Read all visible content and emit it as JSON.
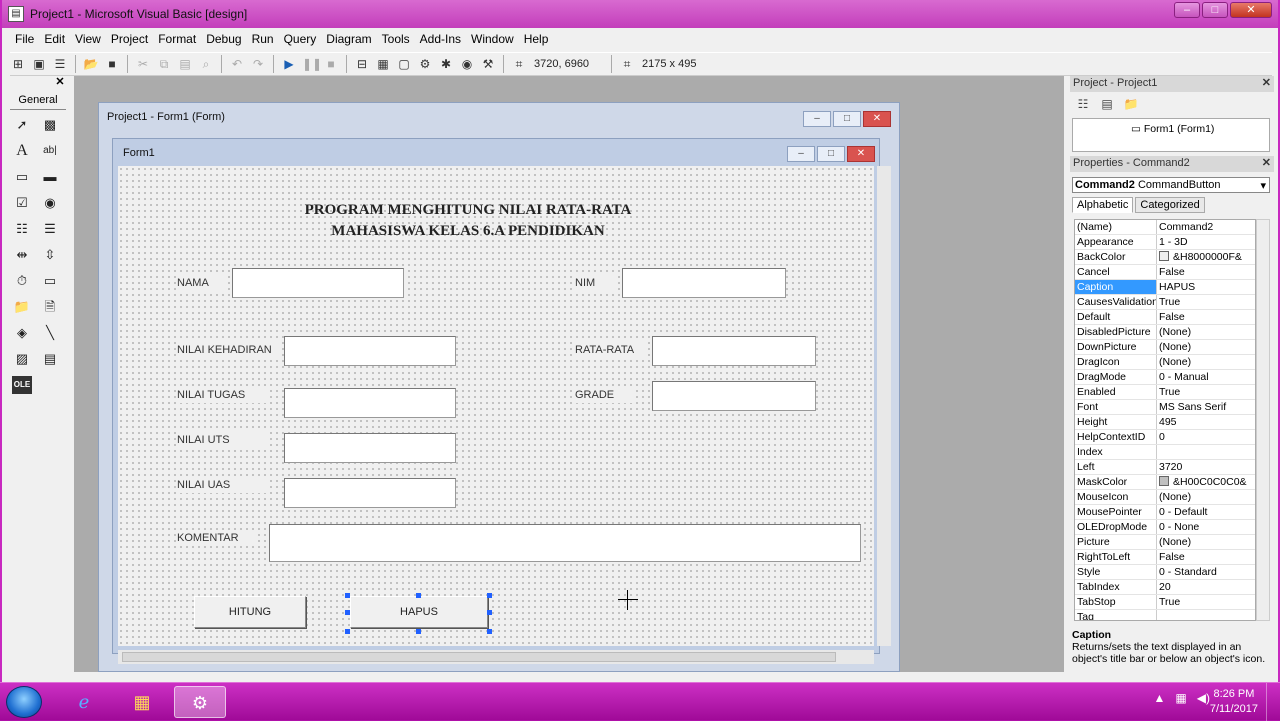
{
  "window": {
    "title": "Project1 - Microsoft Visual Basic [design]",
    "min": "–",
    "max": "□",
    "close": "✕"
  },
  "menu": [
    "File",
    "Edit",
    "View",
    "Project",
    "Format",
    "Debug",
    "Run",
    "Query",
    "Diagram",
    "Tools",
    "Add-Ins",
    "Window",
    "Help"
  ],
  "toolbar": {
    "position": "3720, 6960",
    "size": "2175 x 495"
  },
  "toolbox": {
    "close": "✕",
    "tab": "General"
  },
  "project_window": {
    "title": "Project1 - Form1 (Form)"
  },
  "form_window": {
    "title": "Form1"
  },
  "form": {
    "title_line1": "PROGRAM MENGHITUNG NILAI RATA-RATA",
    "title_line2": "MAHASISWA KELAS 6.A PENDIDIKAN",
    "labels": {
      "nama": "NAMA",
      "nim": "NIM",
      "kehadiran": "NILAI KEHADIRAN",
      "rata": "RATA-RATA",
      "tugas": "NILAI TUGAS",
      "grade": "GRADE",
      "uts": "NILAI UTS",
      "uas": "NILAI UAS",
      "komentar": "KOMENTAR"
    },
    "buttons": {
      "hitung": "HITUNG",
      "hapus": "HAPUS"
    }
  },
  "project_explorer": {
    "title": "Project - Project1",
    "close": "✕",
    "node": "Form1 (Form1)"
  },
  "properties": {
    "title": "Properties - Command2",
    "close": "✕",
    "object_name": "Command2",
    "object_type": "CommandButton",
    "tab_alpha": "Alphabetic",
    "tab_cat": "Categorized",
    "rows": [
      {
        "name": "(Name)",
        "value": "Command2"
      },
      {
        "name": "Appearance",
        "value": "1 - 3D"
      },
      {
        "name": "BackColor",
        "value": "&H8000000F&",
        "swatch": "#f0f0f0"
      },
      {
        "name": "Cancel",
        "value": "False"
      },
      {
        "name": "Caption",
        "value": "HAPUS"
      },
      {
        "name": "CausesValidation",
        "value": "True"
      },
      {
        "name": "Default",
        "value": "False"
      },
      {
        "name": "DisabledPicture",
        "value": "(None)"
      },
      {
        "name": "DownPicture",
        "value": "(None)"
      },
      {
        "name": "DragIcon",
        "value": "(None)"
      },
      {
        "name": "DragMode",
        "value": "0 - Manual"
      },
      {
        "name": "Enabled",
        "value": "True"
      },
      {
        "name": "Font",
        "value": "MS Sans Serif"
      },
      {
        "name": "Height",
        "value": "495"
      },
      {
        "name": "HelpContextID",
        "value": "0"
      },
      {
        "name": "Index",
        "value": ""
      },
      {
        "name": "Left",
        "value": "3720"
      },
      {
        "name": "MaskColor",
        "value": "&H00C0C0C0&",
        "swatch": "#c0c0c0"
      },
      {
        "name": "MouseIcon",
        "value": "(None)"
      },
      {
        "name": "MousePointer",
        "value": "0 - Default"
      },
      {
        "name": "OLEDropMode",
        "value": "0 - None"
      },
      {
        "name": "Picture",
        "value": "(None)"
      },
      {
        "name": "RightToLeft",
        "value": "False"
      },
      {
        "name": "Style",
        "value": "0 - Standard"
      },
      {
        "name": "TabIndex",
        "value": "20"
      },
      {
        "name": "TabStop",
        "value": "True"
      },
      {
        "name": "Tag",
        "value": ""
      }
    ],
    "selected": "Caption",
    "desc_title": "Caption",
    "desc_text": "Returns/sets the text displayed in an object's title bar or below an object's icon."
  },
  "taskbar": {
    "time": "8:26 PM",
    "date": "7/11/2017"
  }
}
